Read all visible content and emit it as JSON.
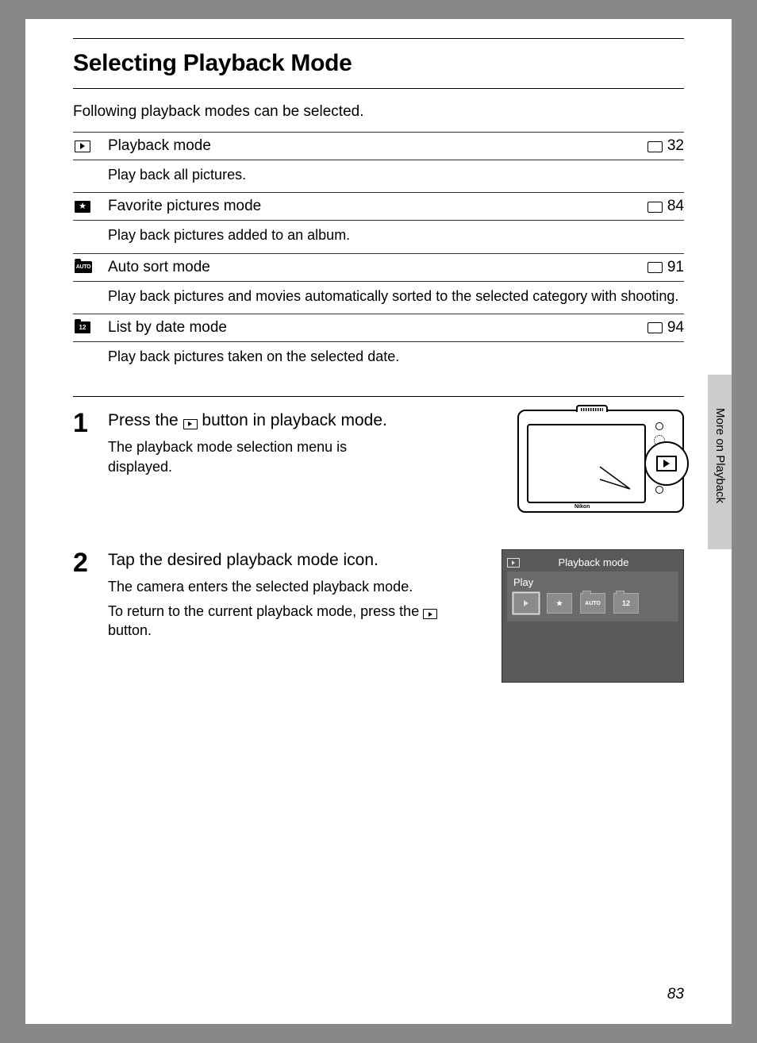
{
  "title": "Selecting Playback Mode",
  "intro": "Following playback modes can be selected.",
  "modes": [
    {
      "name": "Playback mode",
      "page": "32",
      "desc": "Play back all pictures."
    },
    {
      "name": "Favorite pictures mode",
      "page": "84",
      "desc": "Play back pictures added to an album."
    },
    {
      "name": "Auto sort mode",
      "page": "91",
      "desc": "Play back pictures and movies automatically sorted to the selected category with shooting."
    },
    {
      "name": "List by date mode",
      "page": "94",
      "desc": "Play back pictures taken on the selected date."
    }
  ],
  "steps": {
    "s1": {
      "num": "1",
      "title_a": "Press the ",
      "title_b": " button in playback mode.",
      "text": "The playback mode selection menu is displayed."
    },
    "s2": {
      "num": "2",
      "title": "Tap the desired playback mode icon.",
      "text1": "The camera enters the selected playback mode.",
      "text2_a": "To return to the current playback mode, press the ",
      "text2_b": " button."
    }
  },
  "camera_brand": "Nikon",
  "screen": {
    "header": "Playback mode",
    "sub": "Play",
    "auto": "AUTO",
    "date": "12"
  },
  "side_label": "More on Playback",
  "page_number": "83",
  "icons": {
    "auto_small": "AUTO",
    "date_small": "12",
    "star": "★"
  }
}
